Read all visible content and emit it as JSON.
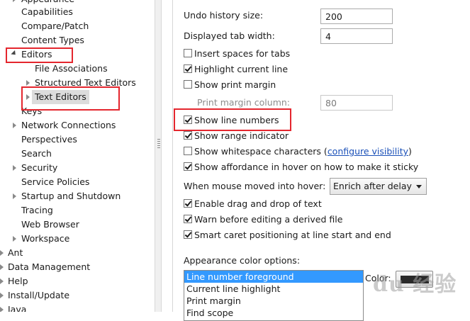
{
  "tree": {
    "items": [
      {
        "label": "Appearance",
        "expander": "closed"
      },
      {
        "label": "Capabilities",
        "expander": "none"
      },
      {
        "label": "Compare/Patch",
        "expander": "none"
      },
      {
        "label": "Content Types",
        "expander": "none"
      },
      {
        "label": "Editors",
        "expander": "open"
      },
      {
        "label": "File Associations",
        "expander": "none"
      },
      {
        "label": "Structured Text Editors",
        "expander": "closed"
      },
      {
        "label": "Text Editors",
        "expander": "closed",
        "selected": true
      },
      {
        "label": "Keys",
        "expander": "none"
      },
      {
        "label": "Network Connections",
        "expander": "closed"
      },
      {
        "label": "Perspectives",
        "expander": "none"
      },
      {
        "label": "Search",
        "expander": "none"
      },
      {
        "label": "Security",
        "expander": "closed"
      },
      {
        "label": "Service Policies",
        "expander": "none"
      },
      {
        "label": "Startup and Shutdown",
        "expander": "closed"
      },
      {
        "label": "Tracing",
        "expander": "none"
      },
      {
        "label": "Web Browser",
        "expander": "none"
      },
      {
        "label": "Workspace",
        "expander": "closed"
      },
      {
        "label": "Ant",
        "expander": "closed"
      },
      {
        "label": "Data Management",
        "expander": "closed"
      },
      {
        "label": "Help",
        "expander": "closed"
      },
      {
        "label": "Install/Update",
        "expander": "closed"
      },
      {
        "label": "Java",
        "expander": "closed"
      }
    ]
  },
  "prefs": {
    "undo_label": "Undo history size:",
    "undo_value": "200",
    "tab_width_label": "Displayed tab width:",
    "tab_width_value": "4",
    "print_margin_column_label": "Print margin column:",
    "print_margin_column_value": "80",
    "checkboxes": [
      {
        "label": "Insert spaces for tabs",
        "checked": false
      },
      {
        "label": "Highlight current line",
        "checked": true
      },
      {
        "label": "Show print margin",
        "checked": false
      },
      {
        "label": "Show line numbers",
        "checked": true
      },
      {
        "label": "Show range indicator",
        "checked": true
      },
      {
        "label": "Show whitespace characters",
        "checked": false
      },
      {
        "label": "Show affordance in hover on how to make it sticky",
        "checked": true
      },
      {
        "label": "Enable drag and drop of text",
        "checked": true
      },
      {
        "label": "Warn before editing a derived file",
        "checked": true
      },
      {
        "label": "Smart caret positioning at line start and end",
        "checked": true
      }
    ],
    "whitespace_link_open": "(",
    "whitespace_link": "configure visibility",
    "whitespace_link_close": ")",
    "hover_label": "When mouse moved into hover:",
    "hover_value": "Enrich after delay",
    "appearance_color_label": "Appearance color options:",
    "color_options": [
      "Line number foreground",
      "Current line highlight",
      "Print margin",
      "Find scope"
    ],
    "color_options_selected": 0,
    "color_label": "Color:",
    "color_swatch": "#2a2a2a"
  },
  "watermark": {
    "text": "du 经验"
  },
  "colors": {
    "highlight_box": "#e4262e",
    "list_selection": "#3399ff",
    "link": "#1a50b8"
  }
}
